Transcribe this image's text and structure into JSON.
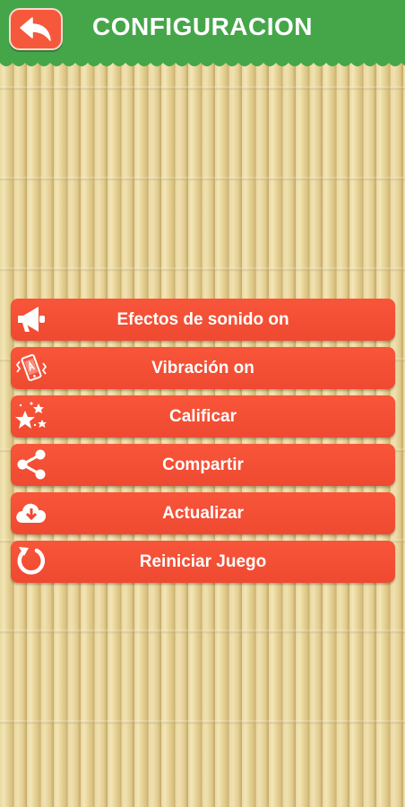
{
  "header": {
    "title": "CONFIGURACION",
    "back_icon": "back-arrow-icon",
    "color": "#45a649"
  },
  "menu": {
    "accent_color": "#f8553a",
    "items": [
      {
        "label": "Efectos de sonido on",
        "icon": "megaphone-icon"
      },
      {
        "label": "Vibración on",
        "icon": "phone-vibration-icon"
      },
      {
        "label": "Calificar",
        "icon": "stars-icon"
      },
      {
        "label": "Compartir",
        "icon": "share-icon"
      },
      {
        "label": "Actualizar",
        "icon": "cloud-download-icon"
      },
      {
        "label": "Reiniciar Juego",
        "icon": "restart-icon"
      }
    ]
  }
}
